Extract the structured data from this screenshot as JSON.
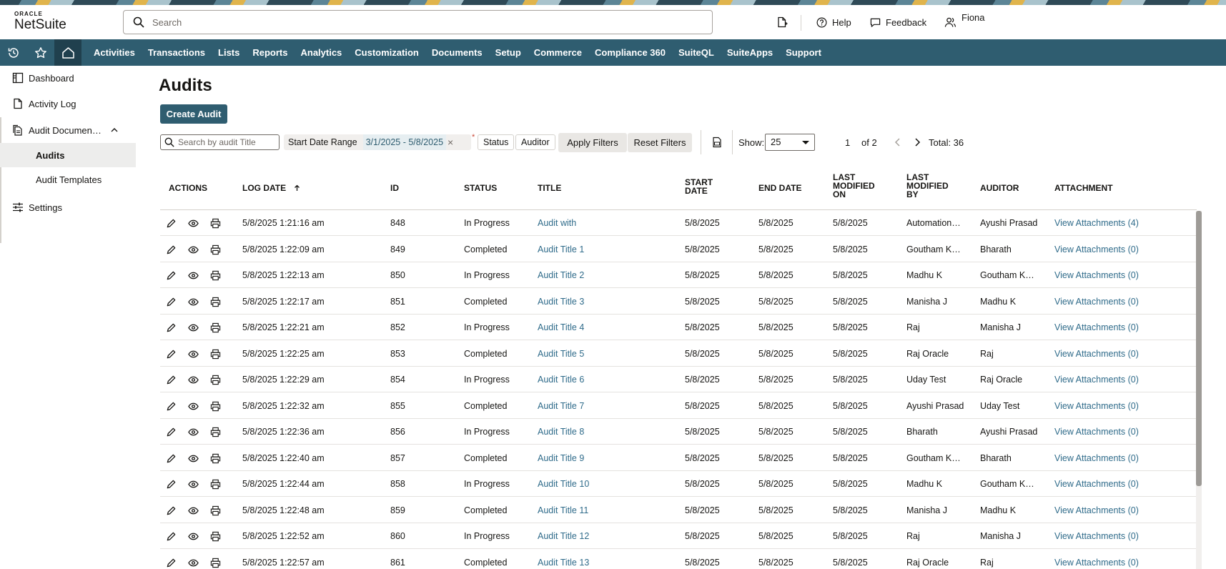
{
  "brand": {
    "oracle": "ORACLE",
    "product": "NetSuite"
  },
  "header": {
    "search_placeholder": "Search",
    "help": "Help",
    "feedback": "Feedback",
    "user": "Fiona"
  },
  "nav": {
    "items": [
      "Activities",
      "Transactions",
      "Lists",
      "Reports",
      "Analytics",
      "Customization",
      "Documents",
      "Setup",
      "Commerce",
      "Compliance 360",
      "SuiteQL",
      "SuiteApps",
      "Support"
    ]
  },
  "sidebar": {
    "items": [
      {
        "label": "Dashboard",
        "icon": "dashboard-icon"
      },
      {
        "label": "Activity Log",
        "icon": "document-icon"
      },
      {
        "label": "Audit Documen…",
        "icon": "documents-icon"
      },
      {
        "label": "Settings",
        "icon": "sliders-icon"
      }
    ],
    "subitems": [
      {
        "label": "Audits",
        "active": true
      },
      {
        "label": "Audit Templates",
        "active": false
      }
    ]
  },
  "page": {
    "title": "Audits",
    "create_button": "Create Audit"
  },
  "filters": {
    "search_placeholder": "Search by audit Title",
    "date_range_label": "Start Date Range",
    "date_range_value": "3/1/2025 - 5/8/2025",
    "remove_glyph": "×",
    "required_marker": "*",
    "status": "Status",
    "auditor": "Auditor",
    "apply": "Apply Filters",
    "reset": "Reset Filters",
    "show_label": "Show:",
    "show_value": "25",
    "page_current": "1",
    "page_of": "of 2",
    "total": "Total: 36"
  },
  "table": {
    "columns": {
      "actions": "ACTIONS",
      "log_date": "LOG DATE",
      "id": "ID",
      "status": "STATUS",
      "title": "TITLE",
      "start_date_1": "START",
      "start_date_2": "DATE",
      "end_date": "END DATE",
      "lmo_1": "LAST",
      "lmo_2": "MODIFIED",
      "lmo_3": "ON",
      "lmb_1": "LAST",
      "lmb_2": "MODIFIED",
      "lmb_3": "BY",
      "auditor": "AUDITOR",
      "attachment": "ATTACHMENT"
    },
    "rows": [
      {
        "log_date": "5/8/2025 1:21:16 am",
        "id": "848",
        "status": "In Progress",
        "title": "Audit with",
        "start": "5/8/2025",
        "end": "5/8/2025",
        "modified_on": "5/8/2025",
        "modified_by": "Automation…",
        "auditor": "Ayushi Prasad",
        "attachment": "View Attachments (4)"
      },
      {
        "log_date": "5/8/2025 1:22:09 am",
        "id": "849",
        "status": "Completed",
        "title": "Audit Title 1",
        "start": "5/8/2025",
        "end": "5/8/2025",
        "modified_on": "5/8/2025",
        "modified_by": "Goutham K…",
        "auditor": "Bharath",
        "attachment": "View Attachments (0)"
      },
      {
        "log_date": "5/8/2025 1:22:13 am",
        "id": "850",
        "status": "In Progress",
        "title": "Audit Title 2",
        "start": "5/8/2025",
        "end": "5/8/2025",
        "modified_on": "5/8/2025",
        "modified_by": "Madhu K",
        "auditor": "Goutham K…",
        "attachment": "View Attachments (0)"
      },
      {
        "log_date": "5/8/2025 1:22:17 am",
        "id": "851",
        "status": "Completed",
        "title": "Audit Title 3",
        "start": "5/8/2025",
        "end": "5/8/2025",
        "modified_on": "5/8/2025",
        "modified_by": "Manisha J",
        "auditor": "Madhu K",
        "attachment": "View Attachments (0)"
      },
      {
        "log_date": "5/8/2025 1:22:21 am",
        "id": "852",
        "status": "In Progress",
        "title": "Audit Title 4",
        "start": "5/8/2025",
        "end": "5/8/2025",
        "modified_on": "5/8/2025",
        "modified_by": "Raj",
        "auditor": "Manisha J",
        "attachment": "View Attachments (0)"
      },
      {
        "log_date": "5/8/2025 1:22:25 am",
        "id": "853",
        "status": "Completed",
        "title": "Audit Title 5",
        "start": "5/8/2025",
        "end": "5/8/2025",
        "modified_on": "5/8/2025",
        "modified_by": "Raj Oracle",
        "auditor": "Raj",
        "attachment": "View Attachments (0)"
      },
      {
        "log_date": "5/8/2025 1:22:29 am",
        "id": "854",
        "status": "In Progress",
        "title": "Audit Title 6",
        "start": "5/8/2025",
        "end": "5/8/2025",
        "modified_on": "5/8/2025",
        "modified_by": "Uday Test",
        "auditor": "Raj Oracle",
        "attachment": "View Attachments (0)"
      },
      {
        "log_date": "5/8/2025 1:22:32 am",
        "id": "855",
        "status": "Completed",
        "title": "Audit Title 7",
        "start": "5/8/2025",
        "end": "5/8/2025",
        "modified_on": "5/8/2025",
        "modified_by": "Ayushi Prasad",
        "auditor": "Uday Test",
        "attachment": "View Attachments (0)"
      },
      {
        "log_date": "5/8/2025 1:22:36 am",
        "id": "856",
        "status": "In Progress",
        "title": "Audit Title 8",
        "start": "5/8/2025",
        "end": "5/8/2025",
        "modified_on": "5/8/2025",
        "modified_by": "Bharath",
        "auditor": "Ayushi Prasad",
        "attachment": "View Attachments (0)"
      },
      {
        "log_date": "5/8/2025 1:22:40 am",
        "id": "857",
        "status": "Completed",
        "title": "Audit Title 9",
        "start": "5/8/2025",
        "end": "5/8/2025",
        "modified_on": "5/8/2025",
        "modified_by": "Goutham K…",
        "auditor": "Bharath",
        "attachment": "View Attachments (0)"
      },
      {
        "log_date": "5/8/2025 1:22:44 am",
        "id": "858",
        "status": "In Progress",
        "title": "Audit Title 10",
        "start": "5/8/2025",
        "end": "5/8/2025",
        "modified_on": "5/8/2025",
        "modified_by": "Madhu K",
        "auditor": "Goutham K…",
        "attachment": "View Attachments (0)"
      },
      {
        "log_date": "5/8/2025 1:22:48 am",
        "id": "859",
        "status": "Completed",
        "title": "Audit Title 11",
        "start": "5/8/2025",
        "end": "5/8/2025",
        "modified_on": "5/8/2025",
        "modified_by": "Manisha J",
        "auditor": "Madhu K",
        "attachment": "View Attachments (0)"
      },
      {
        "log_date": "5/8/2025 1:22:52 am",
        "id": "860",
        "status": "In Progress",
        "title": "Audit Title 12",
        "start": "5/8/2025",
        "end": "5/8/2025",
        "modified_on": "5/8/2025",
        "modified_by": "Raj",
        "auditor": "Manisha J",
        "attachment": "View Attachments (0)"
      },
      {
        "log_date": "5/8/2025 1:22:57 am",
        "id": "861",
        "status": "Completed",
        "title": "Audit Title 13",
        "start": "5/8/2025",
        "end": "5/8/2025",
        "modified_on": "5/8/2025",
        "modified_by": "Raj Oracle",
        "auditor": "Raj",
        "attachment": "View Attachments (0)"
      }
    ]
  },
  "colors": {
    "nav": "#2f5d70",
    "nav_active": "#20404e",
    "link": "#2f6b8a",
    "primary_button": "#2f5d70"
  }
}
